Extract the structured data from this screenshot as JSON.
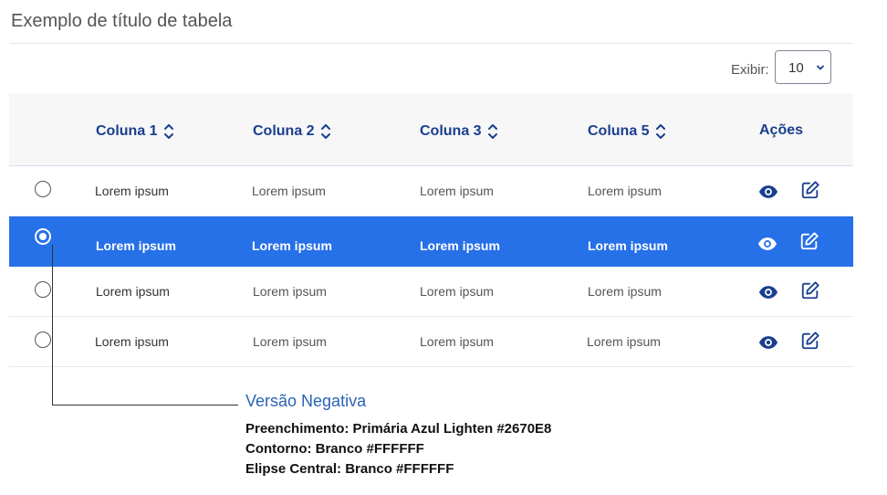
{
  "title": "Exemplo de título de tabela",
  "show": {
    "label": "Exibir:",
    "value": "10"
  },
  "table": {
    "columns": [
      "Coluna 1",
      "Coluna 2",
      "Coluna 3",
      "Coluna 5"
    ],
    "actions_label": "Ações",
    "rows": [
      {
        "cells": [
          "Lorem ipsum",
          "Lorem ipsum",
          "Lorem ipsum",
          "Lorem ipsum"
        ],
        "selected": false
      },
      {
        "cells": [
          "Lorem ipsum",
          "Lorem ipsum",
          "Lorem ipsum",
          "Lorem ipsum"
        ],
        "selected": true
      },
      {
        "cells": [
          "Lorem ipsum",
          "Lorem ipsum",
          "Lorem ipsum",
          "Lorem ipsum"
        ],
        "selected": false
      },
      {
        "cells": [
          "Lorem ipsum",
          "Lorem ipsum",
          "Lorem ipsum",
          "Lorem ipsum"
        ],
        "selected": false
      }
    ]
  },
  "icons": {
    "sort": "sort-icon",
    "view": "eye-icon",
    "edit": "edit-icon",
    "dropdown": "chevron-down-icon"
  },
  "colors": {
    "primary": "#2670E8",
    "header_text": "#1A3F8F",
    "white": "#FFFFFF"
  },
  "callout": {
    "title": "Versão Negativa",
    "lines": [
      "Preenchimento: Primária Azul Lighten #2670E8",
      "Contorno: Branco #FFFFFF",
      "Elipse Central: Branco #FFFFFF"
    ]
  }
}
